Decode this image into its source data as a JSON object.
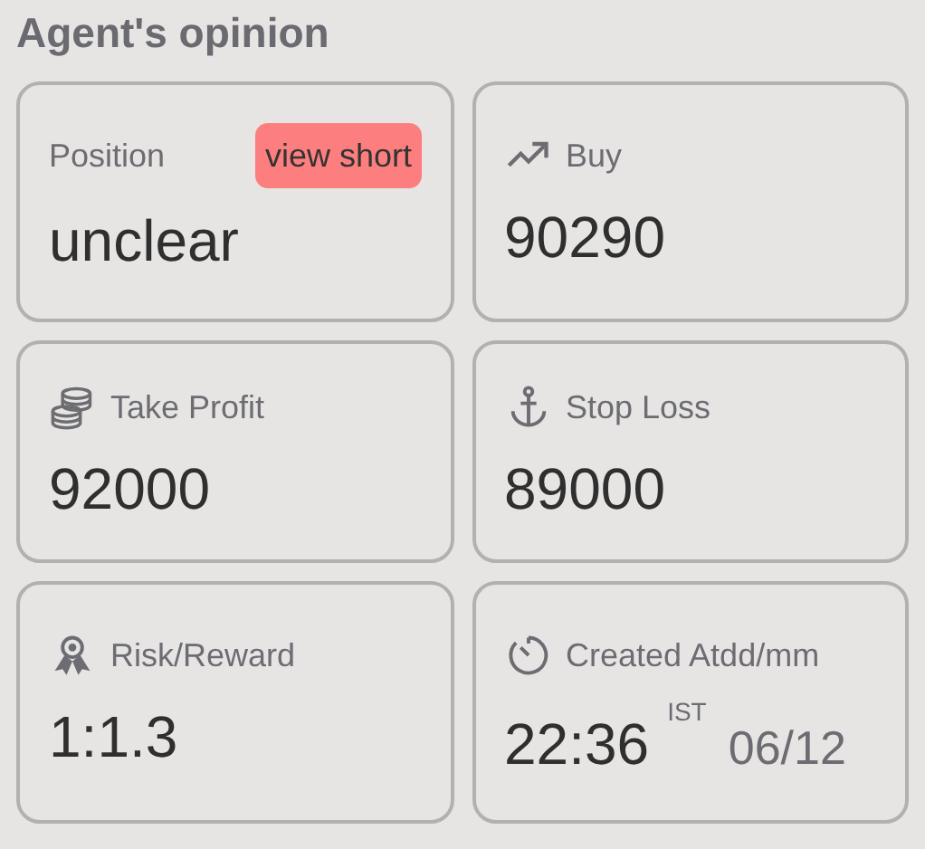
{
  "title": "Agent's opinion",
  "cards": [
    {
      "kind": "position",
      "label": "Position",
      "badge": "view short",
      "value": "unclear"
    },
    {
      "kind": "price",
      "label": "Buy",
      "value": "90290"
    },
    {
      "kind": "price",
      "label": "Take Profit",
      "value": "92000"
    },
    {
      "kind": "price",
      "label": "Stop Loss",
      "value": "89000"
    },
    {
      "kind": "price",
      "label": "Risk/Reward",
      "value": "1:1.3"
    },
    {
      "kind": "time",
      "label": "Created Atdd/mm",
      "value": "22:36",
      "zone": "IST",
      "date": "06/12"
    }
  ]
}
